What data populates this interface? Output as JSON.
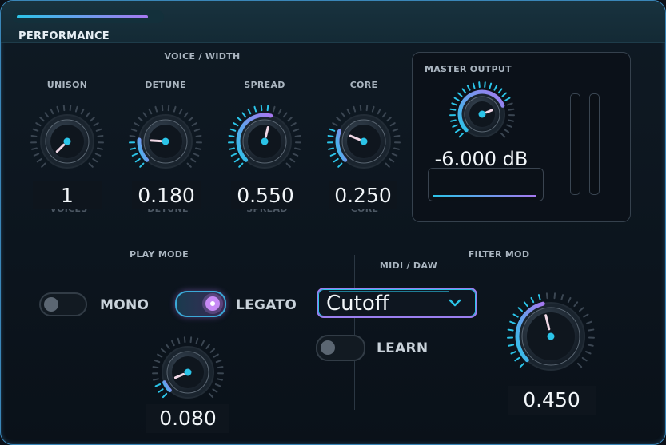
{
  "header": {
    "title": "PERFORMANCE",
    "progress": 0.92
  },
  "voice_width": {
    "title": "VOICE / WIDTH",
    "knobs": [
      {
        "label": "UNISON",
        "value": "1",
        "ghost": "VOICES",
        "level": 0.0
      },
      {
        "label": "DETUNE",
        "value": "0.180",
        "ghost": "DETUNE",
        "level": 0.18
      },
      {
        "label": "SPREAD",
        "value": "0.550",
        "ghost": "SPREAD",
        "level": 0.55
      },
      {
        "label": "CORE",
        "value": "0.250",
        "ghost": "CORE",
        "level": 0.25
      }
    ]
  },
  "master": {
    "title": "MASTER OUTPUT",
    "value": "-6.000 dB",
    "level": 0.75
  },
  "play_mode": {
    "title": "PLAY MODE",
    "mono_label": "MONO",
    "mono_on": false,
    "legato_label": "LEGATO",
    "legato_on": true,
    "glide_value": "0.080",
    "glide_level": 0.08
  },
  "midi": {
    "title": "MIDI / DAW",
    "target": "Cutoff",
    "learn_label": "LEARN",
    "learn_on": false
  },
  "filter_mod": {
    "title": "FILTER MOD",
    "value": "0.450",
    "level": 0.45
  },
  "colors": {
    "accent_cyan": "#2bc4e8",
    "accent_purple": "#a678f0"
  }
}
